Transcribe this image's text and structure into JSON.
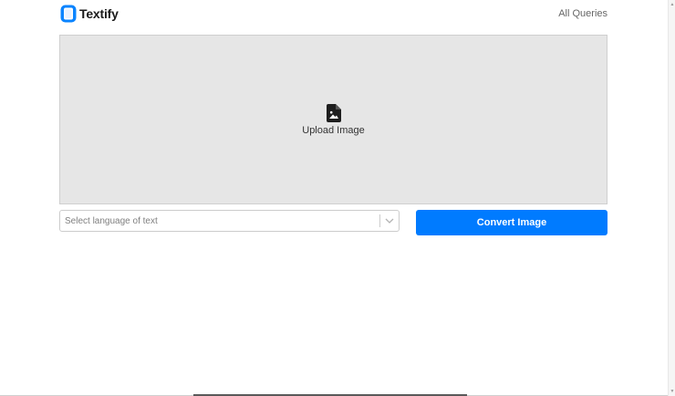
{
  "header": {
    "brand_name": "Textify",
    "brand_logo_icon": "document-icon",
    "nav_all_queries": "All Queries"
  },
  "upload": {
    "label": "Upload Image",
    "icon": "image-file-icon"
  },
  "language_select": {
    "placeholder": "Select language of text",
    "arrow_icon": "chevron-down-icon"
  },
  "convert_button": {
    "label": "Convert Image"
  },
  "colors": {
    "brand_logo": "#0a84ff",
    "primary_button": "#007bff",
    "dropzone_bg": "#e6e6e6"
  }
}
